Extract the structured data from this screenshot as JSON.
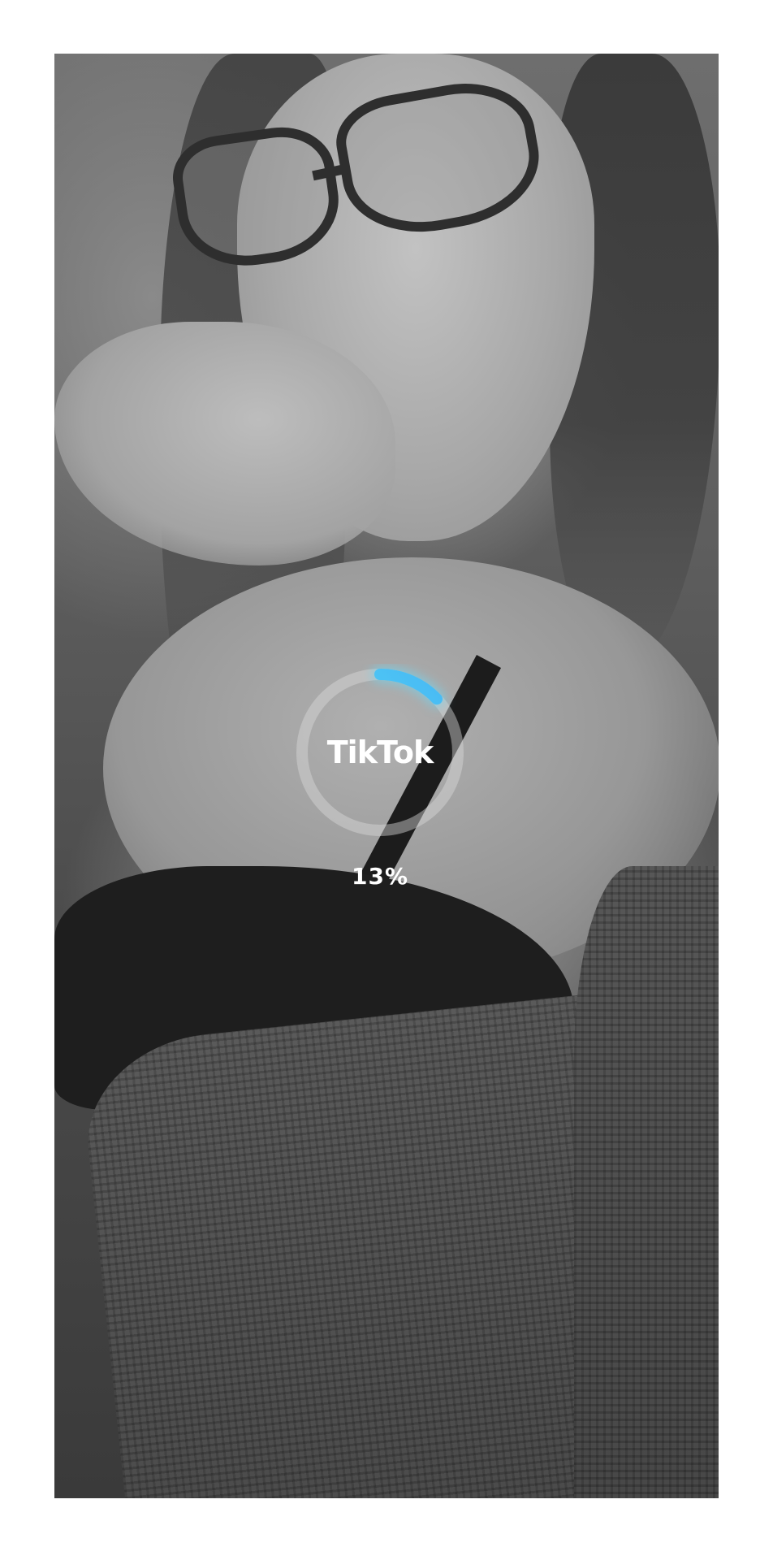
{
  "loading_overlay": {
    "brand": "TikTok",
    "progress_text": "13%",
    "progress_fraction": 0.13,
    "ring_track_color": "#d9d9d9",
    "ring_progress_colors": [
      "#46b6f5",
      "#5ee6f0"
    ]
  },
  "background": {
    "style": "grayscale-photo"
  }
}
